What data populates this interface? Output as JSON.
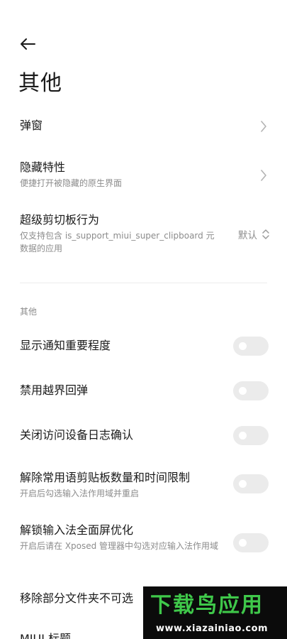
{
  "page": {
    "title": "其他"
  },
  "items": [
    {
      "title": "弹窗"
    },
    {
      "title": "隐藏特性",
      "subtitle": "便捷打开被隐藏的原生界面"
    },
    {
      "title": "超级剪切板行为",
      "subtitle": "仅支持包含 is_support_miui_super_clipboard 元数据的应用",
      "value": "默认"
    }
  ],
  "section": {
    "label": "其他"
  },
  "toggles": [
    {
      "title": "显示通知重要程度",
      "on": false
    },
    {
      "title": "禁用越界回弹",
      "on": false
    },
    {
      "title": "关闭访问设备日志确认",
      "on": false
    },
    {
      "title": "解除常用语剪贴板数量和时间限制",
      "subtitle": "开启后勾选输入法作用域并重启",
      "on": false
    },
    {
      "title": "解锁输入法全面屏优化",
      "subtitle": "开启后请在 Xposed 管理器中勾选对应输入法作用域",
      "on": false
    },
    {
      "title": "移除部分文件夹不可选"
    },
    {
      "title": "MIUI 标题"
    }
  ],
  "watermark": {
    "brand": "下载鸟应用",
    "url": "www.xiazainiao.com"
  },
  "colors": {
    "accent_green": "#3fc84a",
    "toggle_off": "#ebebeb",
    "secondary_text": "#8c8c8c"
  }
}
